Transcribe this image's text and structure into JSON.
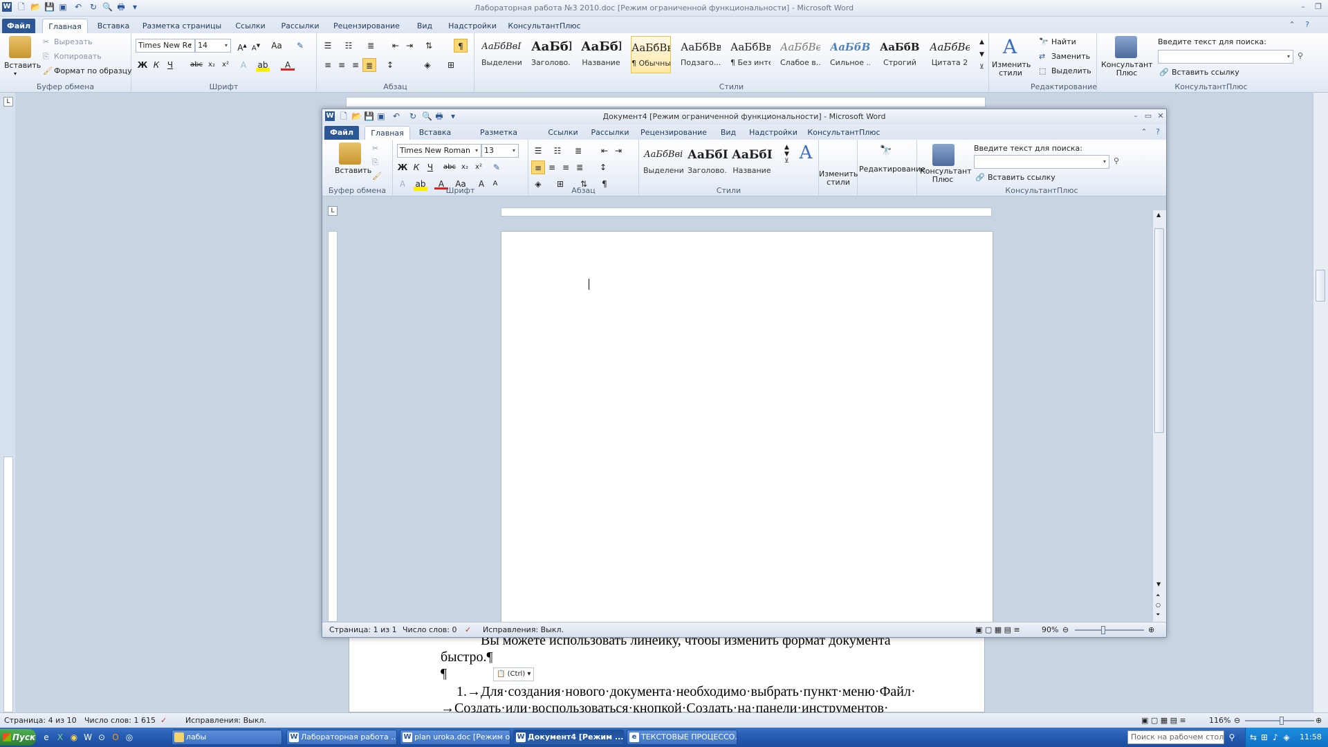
{
  "main_window": {
    "title": "Лабораторная работа №3 2010.doc [Режим ограниченной функциональности]  -  Microsoft Word",
    "tabs": [
      "Файл",
      "Главная",
      "Вставка",
      "Разметка страницы",
      "Ссылки",
      "Рассылки",
      "Рецензирование",
      "Вид",
      "Надстройки",
      "КонсультантПлюс"
    ],
    "clipboard": {
      "paste": "Вставить",
      "cut": "Вырезать",
      "copy": "Копировать",
      "format_painter": "Формат по образцу",
      "label": "Буфер обмена"
    },
    "font": {
      "family": "Times New Rc",
      "size": "14",
      "label": "Шрифт"
    },
    "paragraph_label": "Абзац",
    "styles": [
      {
        "sample": "АаБбВвГ",
        "name": "Выделение"
      },
      {
        "sample": "АаБбГ",
        "name": "Заголово..."
      },
      {
        "sample": "АаБбГ",
        "name": "Название"
      },
      {
        "sample": "АаБбВвГ",
        "name": "¶ Обычный"
      },
      {
        "sample": "АаБбВвІ",
        "name": "Подзаго..."
      },
      {
        "sample": "АаБбВвГ",
        "name": "¶ Без инте..."
      },
      {
        "sample": "АаБбВеГ",
        "name": "Слабое в..."
      },
      {
        "sample": "АаБбВві",
        "name": "Сильное ..."
      },
      {
        "sample": "АаБбВв",
        "name": "Строгий"
      },
      {
        "sample": "АаБбВеГ",
        "name": "Цитата 2"
      }
    ],
    "styles_label": "Стили",
    "change_styles": "Изменить стили",
    "editing": {
      "find": "Найти",
      "replace": "Заменить",
      "select": "Выделить",
      "label": "Редактирование"
    },
    "consultant": {
      "button": "Консультант Плюс",
      "search_label": "Введите текст для поиска:",
      "search_value": "",
      "insert_link": "Вставить ссылку",
      "label": "КонсультантПлюс"
    },
    "document_lines": [
      "Вы можете использовать линейку, чтобы изменить формат документа",
      "быстро.¶",
      "¶",
      "1.→Для·создания·нового·документа·необходимо·выбрать·пункт·меню·Файл·",
      "→Создать·или·воспользоваться·кнопкой·Создать·на·панели·инструментов·"
    ],
    "paste_options": "(Ctrl)",
    "status": {
      "page": "Страница: 4 из 10",
      "words": "Число слов: 1 615",
      "track": "Исправления: Выкл.",
      "zoom": "116%"
    }
  },
  "inner_window": {
    "title": "Документ4 [Режим ограниченной функциональности]  -  Microsoft Word",
    "tabs": [
      "Файл",
      "Главная",
      "Вставка",
      "Разметка страницы",
      "Ссылки",
      "Рассылки",
      "Рецензирование",
      "Вид",
      "Надстройки",
      "КонсультантПлюс"
    ],
    "clipboard": {
      "paste": "Вставить",
      "label": "Буфер обмена"
    },
    "font": {
      "family": "Times New Roman",
      "size": "13",
      "label": "Шрифт"
    },
    "paragraph_label": "Абзац",
    "styles": [
      {
        "sample": "АаБбВві",
        "name": "Выделение"
      },
      {
        "sample": "АаБбГ",
        "name": "Заголово..."
      },
      {
        "sample": "АаБбГ",
        "name": "Название"
      }
    ],
    "styles_label": "Стили",
    "change_styles": "Изменить стили",
    "editing": "Редактирование",
    "consultant": {
      "button": "Консультант Плюс",
      "search_label": "Введите текст для поиска:",
      "search_value": "",
      "insert_link": "Вставить ссылку",
      "label": "КонсультантПлюс"
    },
    "status": {
      "page": "Страница: 1 из 1",
      "words": "Число слов: 0",
      "track": "Исправления: Выкл.",
      "zoom": "90%"
    }
  },
  "taskbar": {
    "start": "Пуск",
    "folder": "лабы",
    "items": [
      "Лабораторная работа ...",
      "plan uroka.doc [Режим о...",
      "Документ4 [Режим ...",
      "ТЕКСТОВЫЕ ПРОЦЕССО..."
    ],
    "desktop_search": "Поиск на рабочем столе",
    "clock": "11:58"
  },
  "colors": {
    "file_tab": "#2b5797",
    "taskbar": "#245ab0",
    "accent": "#f2c04f"
  }
}
